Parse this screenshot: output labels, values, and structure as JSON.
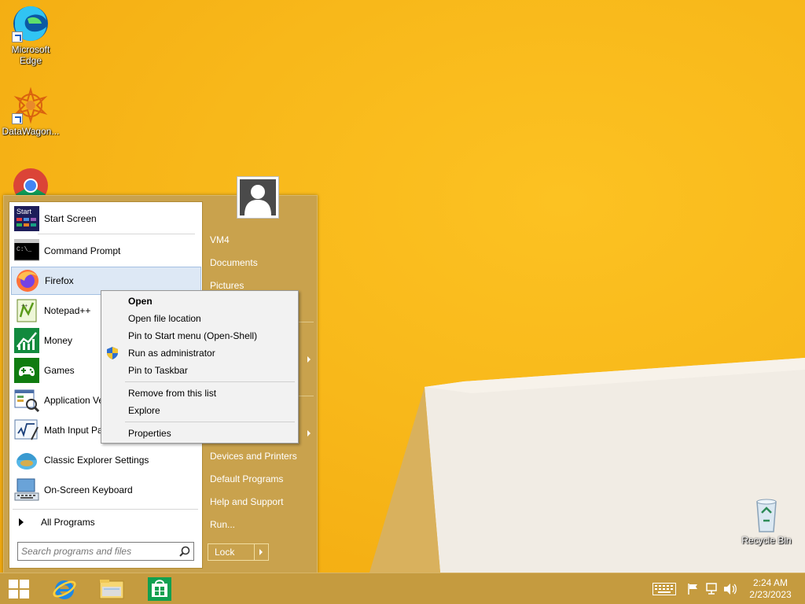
{
  "desktop": {
    "icons": [
      {
        "label": "Microsoft Edge",
        "line1": "Microsoft",
        "line2": "Edge",
        "icon": "edge-icon"
      },
      {
        "label": "DataWagon...",
        "icon": "datawagon-icon"
      },
      {
        "label": "Google Chrome",
        "icon": "chrome-icon"
      },
      {
        "label": "Recycle Bin",
        "icon": "recycle-bin-icon"
      }
    ]
  },
  "start_menu": {
    "programs": [
      {
        "label": "Start Screen",
        "icon": "start-screen-icon"
      },
      {
        "label": "Command Prompt",
        "icon": "command-prompt-icon"
      },
      {
        "label": "Firefox",
        "icon": "firefox-icon"
      },
      {
        "label": "Notepad++",
        "icon": "notepad-plus-plus-icon"
      },
      {
        "label": "Money",
        "icon": "money-icon"
      },
      {
        "label": "Games",
        "icon": "games-icon"
      },
      {
        "label": "Application Ve",
        "icon": "application-verifier-icon"
      },
      {
        "label": "Math Input Par",
        "icon": "math-input-panel-icon"
      },
      {
        "label": "Classic Explorer Settings",
        "icon": "classic-explorer-icon"
      },
      {
        "label": "On-Screen Keyboard",
        "icon": "onscreen-keyboard-icon"
      }
    ],
    "all_programs": "All Programs",
    "search_placeholder": "Search programs and files",
    "right_items": [
      "VM4",
      "Documents",
      "Pictures",
      "Devices and Printers",
      "Default Programs",
      "Help and Support",
      "Run..."
    ],
    "lock_label": "Lock",
    "start_tile_text": "Start"
  },
  "context_menu": {
    "items": [
      "Open",
      "Open file location",
      "Pin to Start menu (Open-Shell)",
      "Run as administrator",
      "Pin to Taskbar",
      "Remove from this list",
      "Explore",
      "Properties"
    ]
  },
  "taskbar": {
    "pinned": [
      "start-button",
      "internet-explorer-icon",
      "file-explorer-icon",
      "store-icon"
    ],
    "clock_time": "2:24 AM",
    "clock_date": "2/23/2023"
  }
}
